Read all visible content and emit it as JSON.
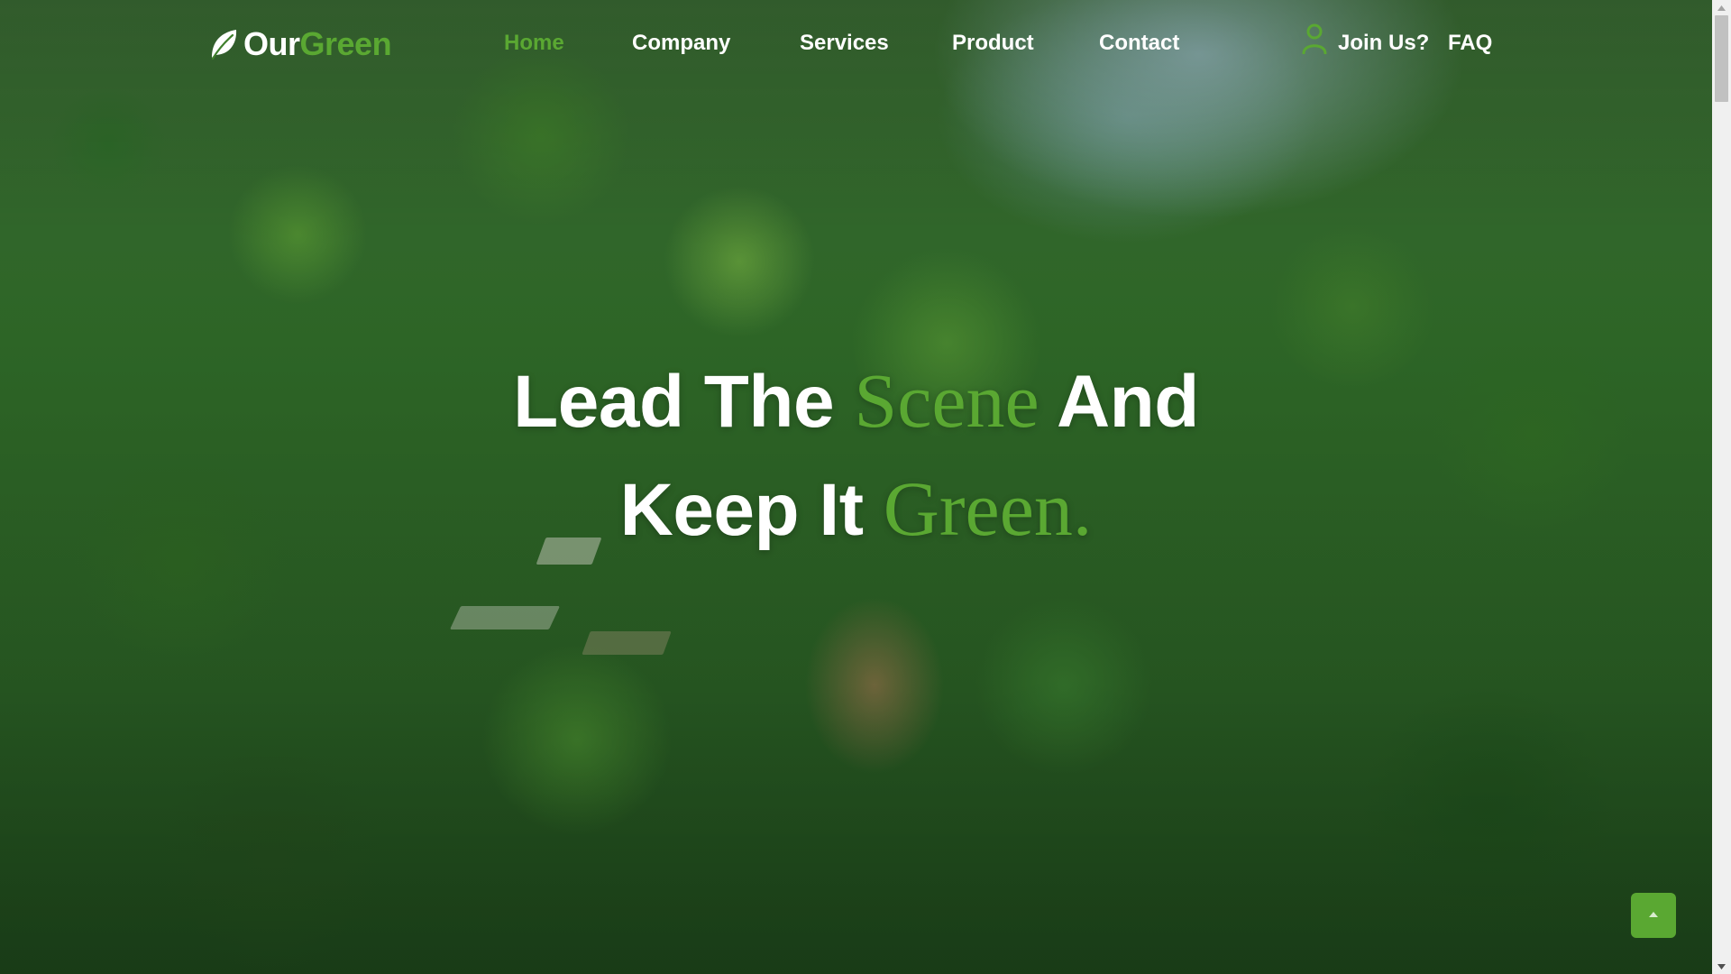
{
  "brand": {
    "name_part1": "Our",
    "name_part2": "Green",
    "icon": "leaf-icon",
    "accent_color": "#5aa832"
  },
  "nav": {
    "items": [
      {
        "label": "Home",
        "active": true
      },
      {
        "label": "Company",
        "active": false
      },
      {
        "label": "Services",
        "active": false
      },
      {
        "label": "Product",
        "active": false
      },
      {
        "label": "Contact",
        "active": false
      }
    ],
    "join_label": "Join Us?",
    "join_icon": "user-icon",
    "faq_label": "FAQ"
  },
  "hero": {
    "line1_part1": "Lead The ",
    "line1_accent": "Scene",
    "line1_part2": " And",
    "line2_part1": "Keep It ",
    "line2_accent": "Green."
  },
  "back_to_top": {
    "icon": "arrow-up-icon"
  }
}
